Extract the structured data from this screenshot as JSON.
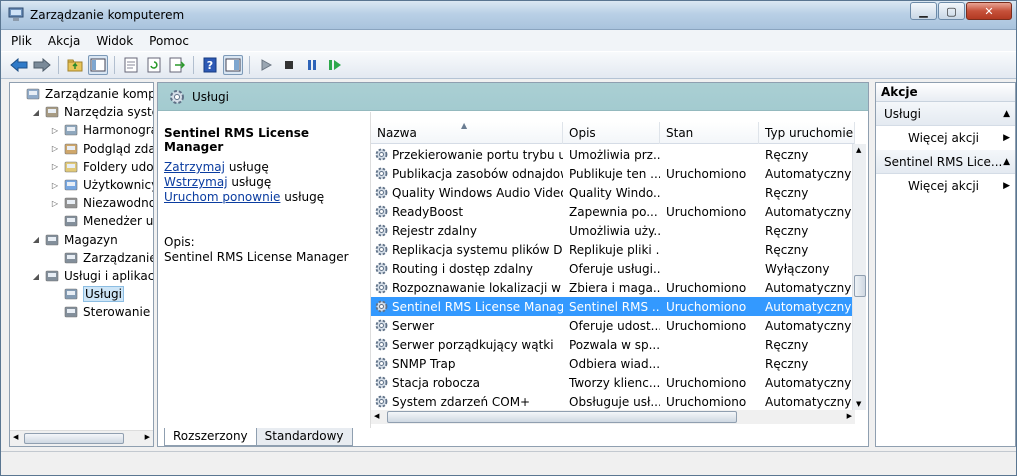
{
  "window": {
    "title": "Zarządzanie komputerem"
  },
  "menu": [
    "Plik",
    "Akcja",
    "Widok",
    "Pomoc"
  ],
  "tree": [
    {
      "label": "Zarządzanie komputer",
      "indent": 0,
      "arrow": ""
    },
    {
      "label": "Narzędzia systemo",
      "indent": 1,
      "arrow": "◢"
    },
    {
      "label": "Harmonogram",
      "indent": 2,
      "arrow": "▷"
    },
    {
      "label": "Podgląd zdarze",
      "indent": 2,
      "arrow": "▷"
    },
    {
      "label": "Foldery udostę",
      "indent": 2,
      "arrow": "▷"
    },
    {
      "label": "Użytkownicy i g",
      "indent": 2,
      "arrow": "▷"
    },
    {
      "label": "Niezawodność",
      "indent": 2,
      "arrow": "▷"
    },
    {
      "label": "Menedżer urzą",
      "indent": 2,
      "arrow": ""
    },
    {
      "label": "Magazyn",
      "indent": 1,
      "arrow": "◢"
    },
    {
      "label": "Zarządzanie dy",
      "indent": 2,
      "arrow": ""
    },
    {
      "label": "Usługi i aplikacje",
      "indent": 1,
      "arrow": "◢"
    },
    {
      "label": "Usługi",
      "indent": 2,
      "arrow": "",
      "selected": true
    },
    {
      "label": "Sterowanie usł",
      "indent": 2,
      "arrow": ""
    }
  ],
  "middle": {
    "header_title": "Usługi",
    "detail": {
      "title": "Sentinel RMS License Manager",
      "stop_link": "Zatrzymaj",
      "pause_link": "Wstrzymaj",
      "restart_link": "Uruchom ponownie",
      "suffix": "usługę",
      "desc_label": "Opis:",
      "desc_text": "Sentinel RMS License Manager"
    },
    "columns": [
      "Nazwa",
      "Opis",
      "Stan",
      "Typ uruchomien"
    ],
    "rows": [
      {
        "name": "Przekierowanie portu trybu uż...",
        "desc": "Umożliwia prz...",
        "state": "",
        "type": "Ręczny"
      },
      {
        "name": "Publikacja zasobów odnajdow...",
        "desc": "Publikuje ten ...",
        "state": "Uruchomiono",
        "type": "Automatyczny"
      },
      {
        "name": "Quality Windows Audio Video...",
        "desc": "Quality Windo...",
        "state": "",
        "type": "Ręczny"
      },
      {
        "name": "ReadyBoost",
        "desc": "Zapewnia po...",
        "state": "Uruchomiono",
        "type": "Automatyczny"
      },
      {
        "name": "Rejestr zdalny",
        "desc": "Umożliwia uży...",
        "state": "",
        "type": "Ręczny"
      },
      {
        "name": "Replikacja systemu plików DFS",
        "desc": "Replikuje pliki ...",
        "state": "",
        "type": "Ręczny"
      },
      {
        "name": "Routing i dostęp zdalny",
        "desc": "Oferuje usługi...",
        "state": "",
        "type": "Wyłączony"
      },
      {
        "name": "Rozpoznawanie lokalizacji w si...",
        "desc": "Zbiera i maga...",
        "state": "Uruchomiono",
        "type": "Automatyczny"
      },
      {
        "name": "Sentinel RMS License Manager",
        "desc": "Sentinel RMS ...",
        "state": "Uruchomiono",
        "type": "Automatyczny",
        "selected": true
      },
      {
        "name": "Serwer",
        "desc": "Oferuje udost...",
        "state": "Uruchomiono",
        "type": "Automatyczny"
      },
      {
        "name": "Serwer porządkujący wątki",
        "desc": "Pozwala w sp...",
        "state": "",
        "type": "Ręczny"
      },
      {
        "name": "SNMP Trap",
        "desc": "Odbiera wiad...",
        "state": "",
        "type": "Ręczny"
      },
      {
        "name": "Stacja robocza",
        "desc": "Tworzy klienc...",
        "state": "Uruchomiono",
        "type": "Automatyczny"
      },
      {
        "name": "System zdarzeń COM+",
        "desc": "Obsługuje usł...",
        "state": "Uruchomiono",
        "type": "Automatyczny"
      }
    ],
    "tabs": [
      "Rozszerzony",
      "Standardowy"
    ]
  },
  "actions": {
    "header": "Akcje",
    "items": [
      {
        "label": "Usługi",
        "kind": "group",
        "arrow": "▲"
      },
      {
        "label": "Więcej akcji",
        "kind": "sub",
        "arrow": "▶"
      },
      {
        "label": "Sentinel RMS Lice...",
        "kind": "group",
        "arrow": "▲"
      },
      {
        "label": "Więcej akcji",
        "kind": "sub",
        "arrow": "▶"
      }
    ]
  },
  "icons": [
    "app-icon",
    "back-icon",
    "forward-icon",
    "up-folder-icon",
    "console-tree-icon",
    "export-icon",
    "refresh-icon",
    "export-list-icon",
    "help-icon",
    "show-hide-icon",
    "start-icon",
    "stop-icon",
    "pause-icon",
    "resume-icon",
    "gear-icon"
  ],
  "colors": {
    "selection": "#3399ff",
    "header_band": "#a3cbd0",
    "link": "#0a3ca0"
  }
}
